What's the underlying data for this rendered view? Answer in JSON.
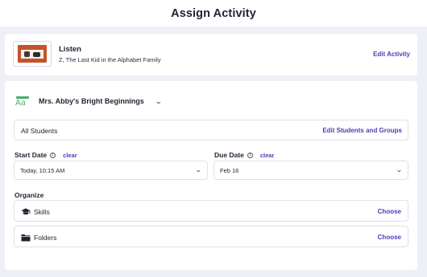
{
  "header": {
    "title": "Assign Activity"
  },
  "activity": {
    "title": "Listen",
    "subtitle": "Z, The Last Kid in the Alphabet Family",
    "edit_label": "Edit Activity"
  },
  "class_selector": {
    "icon_text": "Aa",
    "name": "Mrs. Abby's Bright Beginnings"
  },
  "students": {
    "label": "All Students",
    "edit_label": "Edit Students and Groups"
  },
  "start_date": {
    "label": "Start Date",
    "clear_label": "clear",
    "value": "Today, 10:15 AM"
  },
  "due_date": {
    "label": "Due Date",
    "clear_label": "clear",
    "value": "Feb 16"
  },
  "organize": {
    "label": "Organize",
    "items": [
      {
        "label": "Skills",
        "action": "Choose",
        "icon": "graduation-cap-icon"
      },
      {
        "label": "Folders",
        "action": "Choose",
        "icon": "folder-icon"
      }
    ]
  },
  "colors": {
    "link": "#4a3fb5",
    "background": "#eef0f5",
    "class_icon": "#45b06a"
  }
}
